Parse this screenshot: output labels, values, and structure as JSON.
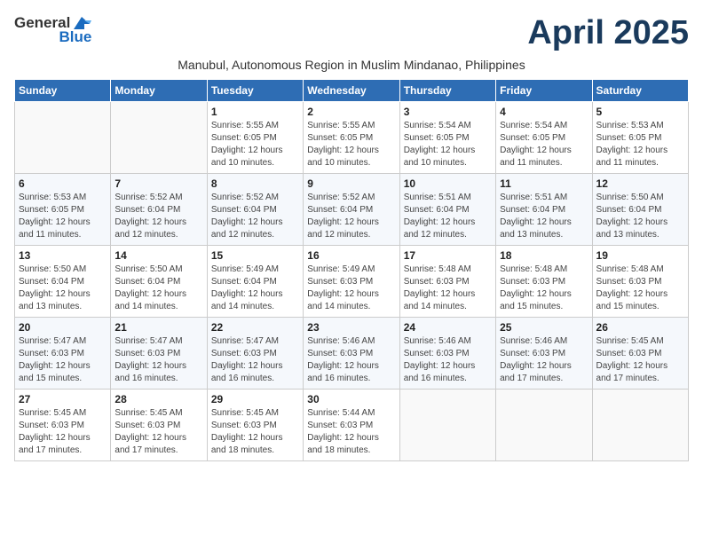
{
  "logo": {
    "general": "General",
    "blue": "Blue"
  },
  "title": "April 2025",
  "subtitle": "Manubul, Autonomous Region in Muslim Mindanao, Philippines",
  "weekdays": [
    "Sunday",
    "Monday",
    "Tuesday",
    "Wednesday",
    "Thursday",
    "Friday",
    "Saturday"
  ],
  "weeks": [
    [
      null,
      null,
      {
        "day": 1,
        "sunrise": "5:55 AM",
        "sunset": "6:05 PM",
        "daylight": "12 hours and 10 minutes."
      },
      {
        "day": 2,
        "sunrise": "5:55 AM",
        "sunset": "6:05 PM",
        "daylight": "12 hours and 10 minutes."
      },
      {
        "day": 3,
        "sunrise": "5:54 AM",
        "sunset": "6:05 PM",
        "daylight": "12 hours and 10 minutes."
      },
      {
        "day": 4,
        "sunrise": "5:54 AM",
        "sunset": "6:05 PM",
        "daylight": "12 hours and 11 minutes."
      },
      {
        "day": 5,
        "sunrise": "5:53 AM",
        "sunset": "6:05 PM",
        "daylight": "12 hours and 11 minutes."
      }
    ],
    [
      {
        "day": 6,
        "sunrise": "5:53 AM",
        "sunset": "6:05 PM",
        "daylight": "12 hours and 11 minutes."
      },
      {
        "day": 7,
        "sunrise": "5:52 AM",
        "sunset": "6:04 PM",
        "daylight": "12 hours and 12 minutes."
      },
      {
        "day": 8,
        "sunrise": "5:52 AM",
        "sunset": "6:04 PM",
        "daylight": "12 hours and 12 minutes."
      },
      {
        "day": 9,
        "sunrise": "5:52 AM",
        "sunset": "6:04 PM",
        "daylight": "12 hours and 12 minutes."
      },
      {
        "day": 10,
        "sunrise": "5:51 AM",
        "sunset": "6:04 PM",
        "daylight": "12 hours and 12 minutes."
      },
      {
        "day": 11,
        "sunrise": "5:51 AM",
        "sunset": "6:04 PM",
        "daylight": "12 hours and 13 minutes."
      },
      {
        "day": 12,
        "sunrise": "5:50 AM",
        "sunset": "6:04 PM",
        "daylight": "12 hours and 13 minutes."
      }
    ],
    [
      {
        "day": 13,
        "sunrise": "5:50 AM",
        "sunset": "6:04 PM",
        "daylight": "12 hours and 13 minutes."
      },
      {
        "day": 14,
        "sunrise": "5:50 AM",
        "sunset": "6:04 PM",
        "daylight": "12 hours and 14 minutes."
      },
      {
        "day": 15,
        "sunrise": "5:49 AM",
        "sunset": "6:04 PM",
        "daylight": "12 hours and 14 minutes."
      },
      {
        "day": 16,
        "sunrise": "5:49 AM",
        "sunset": "6:03 PM",
        "daylight": "12 hours and 14 minutes."
      },
      {
        "day": 17,
        "sunrise": "5:48 AM",
        "sunset": "6:03 PM",
        "daylight": "12 hours and 14 minutes."
      },
      {
        "day": 18,
        "sunrise": "5:48 AM",
        "sunset": "6:03 PM",
        "daylight": "12 hours and 15 minutes."
      },
      {
        "day": 19,
        "sunrise": "5:48 AM",
        "sunset": "6:03 PM",
        "daylight": "12 hours and 15 minutes."
      }
    ],
    [
      {
        "day": 20,
        "sunrise": "5:47 AM",
        "sunset": "6:03 PM",
        "daylight": "12 hours and 15 minutes."
      },
      {
        "day": 21,
        "sunrise": "5:47 AM",
        "sunset": "6:03 PM",
        "daylight": "12 hours and 16 minutes."
      },
      {
        "day": 22,
        "sunrise": "5:47 AM",
        "sunset": "6:03 PM",
        "daylight": "12 hours and 16 minutes."
      },
      {
        "day": 23,
        "sunrise": "5:46 AM",
        "sunset": "6:03 PM",
        "daylight": "12 hours and 16 minutes."
      },
      {
        "day": 24,
        "sunrise": "5:46 AM",
        "sunset": "6:03 PM",
        "daylight": "12 hours and 16 minutes."
      },
      {
        "day": 25,
        "sunrise": "5:46 AM",
        "sunset": "6:03 PM",
        "daylight": "12 hours and 17 minutes."
      },
      {
        "day": 26,
        "sunrise": "5:45 AM",
        "sunset": "6:03 PM",
        "daylight": "12 hours and 17 minutes."
      }
    ],
    [
      {
        "day": 27,
        "sunrise": "5:45 AM",
        "sunset": "6:03 PM",
        "daylight": "12 hours and 17 minutes."
      },
      {
        "day": 28,
        "sunrise": "5:45 AM",
        "sunset": "6:03 PM",
        "daylight": "12 hours and 17 minutes."
      },
      {
        "day": 29,
        "sunrise": "5:45 AM",
        "sunset": "6:03 PM",
        "daylight": "12 hours and 18 minutes."
      },
      {
        "day": 30,
        "sunrise": "5:44 AM",
        "sunset": "6:03 PM",
        "daylight": "12 hours and 18 minutes."
      },
      null,
      null,
      null
    ]
  ]
}
